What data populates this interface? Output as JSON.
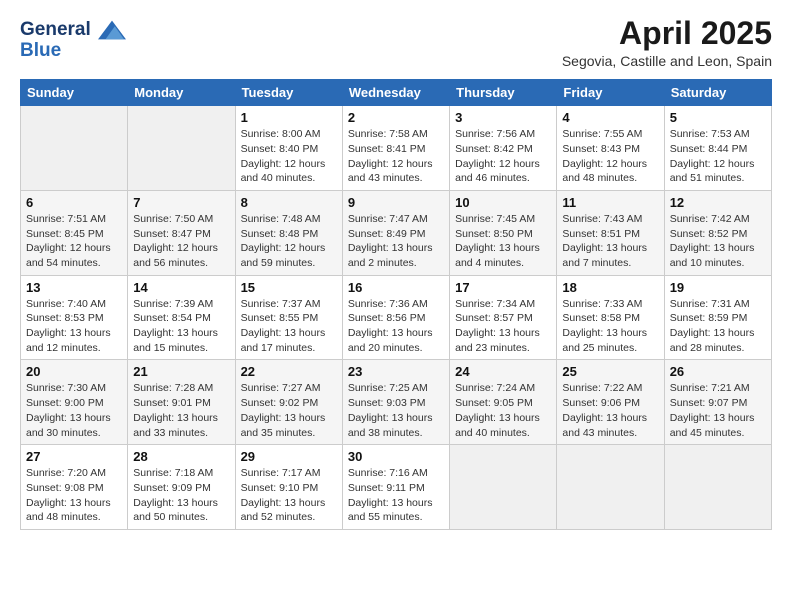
{
  "header": {
    "logo_line1": "General",
    "logo_line2": "Blue",
    "title": "April 2025",
    "subtitle": "Segovia, Castille and Leon, Spain"
  },
  "calendar": {
    "days_of_week": [
      "Sunday",
      "Monday",
      "Tuesday",
      "Wednesday",
      "Thursday",
      "Friday",
      "Saturday"
    ],
    "weeks": [
      [
        {
          "day": "",
          "info": ""
        },
        {
          "day": "",
          "info": ""
        },
        {
          "day": "1",
          "info": "Sunrise: 8:00 AM\nSunset: 8:40 PM\nDaylight: 12 hours and 40 minutes."
        },
        {
          "day": "2",
          "info": "Sunrise: 7:58 AM\nSunset: 8:41 PM\nDaylight: 12 hours and 43 minutes."
        },
        {
          "day": "3",
          "info": "Sunrise: 7:56 AM\nSunset: 8:42 PM\nDaylight: 12 hours and 46 minutes."
        },
        {
          "day": "4",
          "info": "Sunrise: 7:55 AM\nSunset: 8:43 PM\nDaylight: 12 hours and 48 minutes."
        },
        {
          "day": "5",
          "info": "Sunrise: 7:53 AM\nSunset: 8:44 PM\nDaylight: 12 hours and 51 minutes."
        }
      ],
      [
        {
          "day": "6",
          "info": "Sunrise: 7:51 AM\nSunset: 8:45 PM\nDaylight: 12 hours and 54 minutes."
        },
        {
          "day": "7",
          "info": "Sunrise: 7:50 AM\nSunset: 8:47 PM\nDaylight: 12 hours and 56 minutes."
        },
        {
          "day": "8",
          "info": "Sunrise: 7:48 AM\nSunset: 8:48 PM\nDaylight: 12 hours and 59 minutes."
        },
        {
          "day": "9",
          "info": "Sunrise: 7:47 AM\nSunset: 8:49 PM\nDaylight: 13 hours and 2 minutes."
        },
        {
          "day": "10",
          "info": "Sunrise: 7:45 AM\nSunset: 8:50 PM\nDaylight: 13 hours and 4 minutes."
        },
        {
          "day": "11",
          "info": "Sunrise: 7:43 AM\nSunset: 8:51 PM\nDaylight: 13 hours and 7 minutes."
        },
        {
          "day": "12",
          "info": "Sunrise: 7:42 AM\nSunset: 8:52 PM\nDaylight: 13 hours and 10 minutes."
        }
      ],
      [
        {
          "day": "13",
          "info": "Sunrise: 7:40 AM\nSunset: 8:53 PM\nDaylight: 13 hours and 12 minutes."
        },
        {
          "day": "14",
          "info": "Sunrise: 7:39 AM\nSunset: 8:54 PM\nDaylight: 13 hours and 15 minutes."
        },
        {
          "day": "15",
          "info": "Sunrise: 7:37 AM\nSunset: 8:55 PM\nDaylight: 13 hours and 17 minutes."
        },
        {
          "day": "16",
          "info": "Sunrise: 7:36 AM\nSunset: 8:56 PM\nDaylight: 13 hours and 20 minutes."
        },
        {
          "day": "17",
          "info": "Sunrise: 7:34 AM\nSunset: 8:57 PM\nDaylight: 13 hours and 23 minutes."
        },
        {
          "day": "18",
          "info": "Sunrise: 7:33 AM\nSunset: 8:58 PM\nDaylight: 13 hours and 25 minutes."
        },
        {
          "day": "19",
          "info": "Sunrise: 7:31 AM\nSunset: 8:59 PM\nDaylight: 13 hours and 28 minutes."
        }
      ],
      [
        {
          "day": "20",
          "info": "Sunrise: 7:30 AM\nSunset: 9:00 PM\nDaylight: 13 hours and 30 minutes."
        },
        {
          "day": "21",
          "info": "Sunrise: 7:28 AM\nSunset: 9:01 PM\nDaylight: 13 hours and 33 minutes."
        },
        {
          "day": "22",
          "info": "Sunrise: 7:27 AM\nSunset: 9:02 PM\nDaylight: 13 hours and 35 minutes."
        },
        {
          "day": "23",
          "info": "Sunrise: 7:25 AM\nSunset: 9:03 PM\nDaylight: 13 hours and 38 minutes."
        },
        {
          "day": "24",
          "info": "Sunrise: 7:24 AM\nSunset: 9:05 PM\nDaylight: 13 hours and 40 minutes."
        },
        {
          "day": "25",
          "info": "Sunrise: 7:22 AM\nSunset: 9:06 PM\nDaylight: 13 hours and 43 minutes."
        },
        {
          "day": "26",
          "info": "Sunrise: 7:21 AM\nSunset: 9:07 PM\nDaylight: 13 hours and 45 minutes."
        }
      ],
      [
        {
          "day": "27",
          "info": "Sunrise: 7:20 AM\nSunset: 9:08 PM\nDaylight: 13 hours and 48 minutes."
        },
        {
          "day": "28",
          "info": "Sunrise: 7:18 AM\nSunset: 9:09 PM\nDaylight: 13 hours and 50 minutes."
        },
        {
          "day": "29",
          "info": "Sunrise: 7:17 AM\nSunset: 9:10 PM\nDaylight: 13 hours and 52 minutes."
        },
        {
          "day": "30",
          "info": "Sunrise: 7:16 AM\nSunset: 9:11 PM\nDaylight: 13 hours and 55 minutes."
        },
        {
          "day": "",
          "info": ""
        },
        {
          "day": "",
          "info": ""
        },
        {
          "day": "",
          "info": ""
        }
      ]
    ]
  }
}
